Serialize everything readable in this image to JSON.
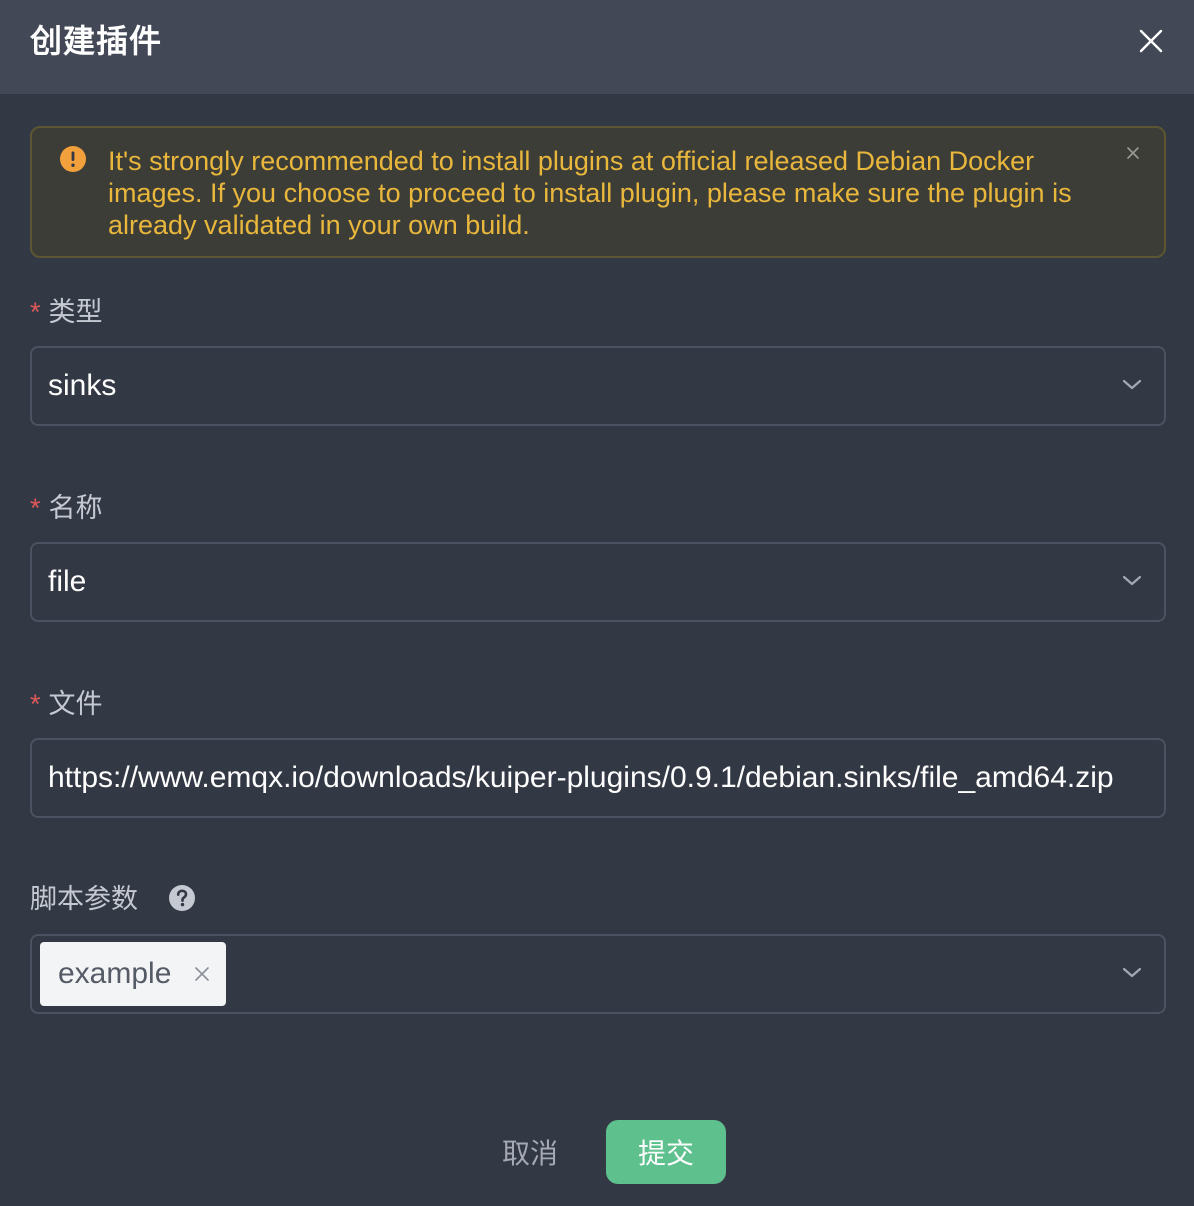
{
  "dialog": {
    "title": "创建插件",
    "close_icon": "close-icon"
  },
  "alert": {
    "icon": "warning-icon",
    "text": "It's strongly recommended to install plugins at official released Debian Docker images. If you choose to proceed to install plugin, please make sure the plugin is already validated in your own build.",
    "close_icon": "close-icon"
  },
  "form": {
    "required_mark": "*",
    "type": {
      "label": "类型",
      "value": "sinks"
    },
    "name": {
      "label": "名称",
      "value": "file"
    },
    "file": {
      "label": "文件",
      "value": "https://www.emqx.io/downloads/kuiper-plugins/0.9.1/debian.sinks/file_amd64.zip"
    },
    "script_params": {
      "label": "脚本参数",
      "help_icon": "question-icon",
      "tags": [
        "example"
      ]
    }
  },
  "footer": {
    "cancel_label": "取消",
    "submit_label": "提交"
  },
  "colors": {
    "background": "#333845",
    "header": "#424856",
    "warning": "#e8b73c",
    "required": "#e0585a",
    "primary": "#5ec08d"
  }
}
